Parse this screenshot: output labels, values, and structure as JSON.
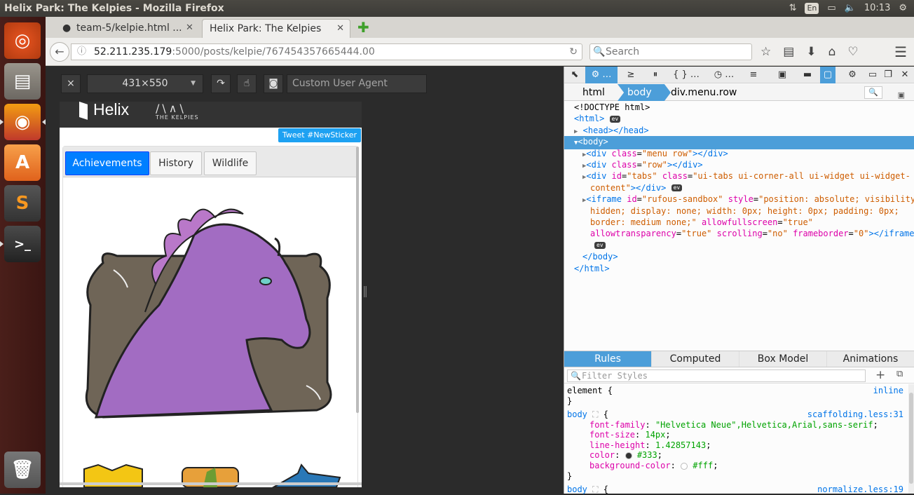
{
  "topbar": {
    "title": "Helix Park: The Kelpies - Mozilla Firefox",
    "lang": "En",
    "time": "10:13"
  },
  "tabs": [
    {
      "label": "team-5/kelpie.html ..."
    },
    {
      "label": "Helix Park: The Kelpies"
    }
  ],
  "nav": {
    "url_host": "52.211.235.179",
    "url_rest": ":5000/posts/kelpie/767454357665444.00",
    "search_placeholder": "Search"
  },
  "rdm": {
    "size": "431×550",
    "ua_placeholder": "Custom User Agent"
  },
  "page": {
    "logo": "Helix",
    "subtitle": "THE KELPIES",
    "tweet": "Tweet #NewSticker",
    "tabs": [
      "Achievements",
      "History",
      "Wildlife"
    ],
    "selected_tab": "Achievements"
  },
  "devtools": {
    "crumbs": [
      "html",
      "body",
      "div.menu.row"
    ],
    "markup": [
      {
        "t": "<!DOCTYPE html>"
      },
      {
        "t": "<html>",
        "ev": true
      },
      {
        "t": "<head></head>"
      },
      {
        "t": "<body>"
      },
      {
        "t": "<div class=\"menu row\"></div>"
      },
      {
        "t": "<div class=\"row\"></div>"
      },
      {
        "t": "<div id=\"tabs\" class=\"ui-tabs ui-corner-all ui-widget ui-widget-"
      },
      {
        "t": "content\"></div>",
        "ev": true
      },
      {
        "t": "<iframe id=\"rufous-sandbox\" style=\"position: absolute; visibility:"
      },
      {
        "t": "hidden; display: none; width: 0px; height: 0px; padding: 0px;"
      },
      {
        "t": "border: medium none;\" allowfullscreen=\"true\""
      },
      {
        "t": "allowtransparency=\"true\" scrolling=\"no\" frameborder=\"0\"></iframe>"
      },
      {
        "t": "",
        "ev": true
      },
      {
        "t": "</body>"
      },
      {
        "t": "</html>"
      }
    ],
    "panel_tabs": [
      "Rules",
      "Computed",
      "Box Model",
      "Animations"
    ],
    "filter_placeholder": "Filter Styles",
    "rules": {
      "element": {
        "selector": "element",
        "source": "inline"
      },
      "body1": {
        "selector": "body",
        "source": "scaffolding.less:31",
        "props": [
          [
            "font-family",
            "\"Helvetica Neue\",Helvetica,Arial,sans-serif"
          ],
          [
            "font-size",
            "14px"
          ],
          [
            "line-height",
            "1.42857143"
          ],
          [
            "color",
            "#333"
          ],
          [
            "background-color",
            "#fff"
          ]
        ]
      },
      "body2": {
        "selector": "body",
        "source": "normalize.less:19"
      }
    },
    "colors": {
      "accent": "#4c9ed9"
    }
  }
}
